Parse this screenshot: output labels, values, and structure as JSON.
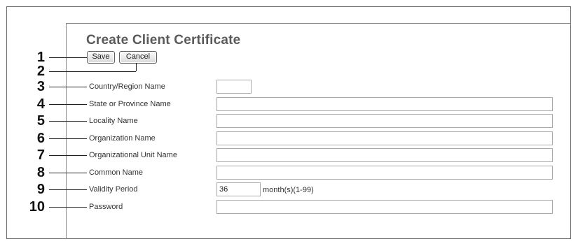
{
  "page": {
    "title": "Create Client Certificate",
    "save_label": "Save",
    "cancel_label": "Cancel"
  },
  "callouts": [
    "1",
    "2",
    "3",
    "4",
    "5",
    "6",
    "7",
    "8",
    "9",
    "10"
  ],
  "form": {
    "country_label": "Country/Region Name",
    "country_value": "",
    "state_label": "State or Province Name",
    "state_value": "",
    "locality_label": "Locality Name",
    "locality_value": "",
    "organization_label": "Organization Name",
    "organization_value": "",
    "org_unit_label": "Organizational Unit Name",
    "org_unit_value": "",
    "common_name_label": "Common Name",
    "common_name_value": "",
    "validity_label": "Validity Period",
    "validity_value": "36",
    "validity_unit": "month(s)(1-99)",
    "password_label": "Password",
    "password_value": ""
  }
}
